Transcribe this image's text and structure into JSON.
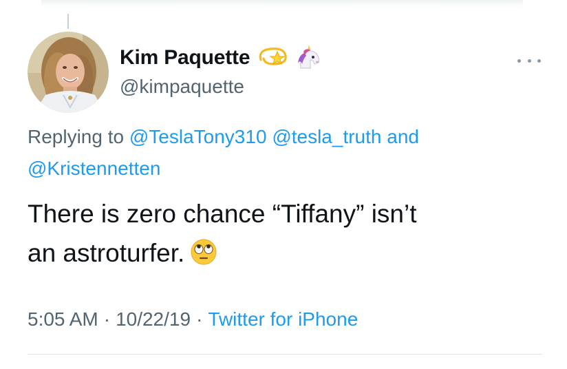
{
  "tweet": {
    "author": {
      "display_name": "Kim Paquette",
      "handle": "@kimpaquette",
      "name_emojis": [
        "dizzy-star-emoji",
        "unicorn-emoji"
      ]
    },
    "replying": {
      "prefix": "Replying to",
      "mentions": [
        "@TeslaTony310",
        "@tesla_truth"
      ],
      "conjunction": "and",
      "last_mention": "@Kristennetten"
    },
    "text_line1": "There is zero chance “Tiffany” isn’t",
    "text_line2": "an astroturfer.",
    "text_emoji": "face-with-rolling-eyes-emoji",
    "time": "5:05 AM",
    "separator": "·",
    "date": "10/22/19",
    "source": "Twitter for iPhone"
  },
  "colors": {
    "text": "#0f1419",
    "secondary": "#536471",
    "link": "#1d9bf0",
    "divider": "#dde3e8"
  }
}
